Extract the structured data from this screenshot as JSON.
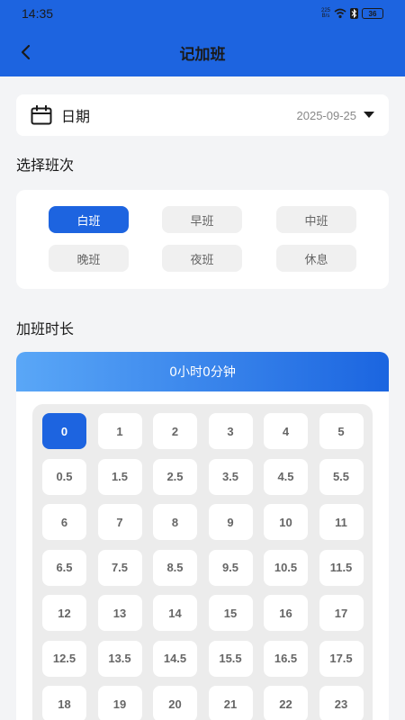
{
  "status_bar": {
    "time": "14:35",
    "net_speed_top": "225",
    "net_speed_bottom": "B/s",
    "battery": "36"
  },
  "header": {
    "title": "记加班"
  },
  "date_row": {
    "label": "日期",
    "value": "2025-09-25"
  },
  "shift_section": {
    "label": "选择班次",
    "options": [
      "白班",
      "早班",
      "中班",
      "晚班",
      "夜班",
      "休息"
    ],
    "selected_index": 0
  },
  "duration_section": {
    "label": "加班时长",
    "summary": "0小时0分钟",
    "hours": [
      "0",
      "1",
      "2",
      "3",
      "4",
      "5",
      "0.5",
      "1.5",
      "2.5",
      "3.5",
      "4.5",
      "5.5",
      "6",
      "7",
      "8",
      "9",
      "10",
      "11",
      "6.5",
      "7.5",
      "8.5",
      "9.5",
      "10.5",
      "11.5",
      "12",
      "13",
      "14",
      "15",
      "16",
      "17",
      "12.5",
      "13.5",
      "14.5",
      "15.5",
      "16.5",
      "17.5",
      "18",
      "19",
      "20",
      "21",
      "22",
      "23"
    ],
    "selected_index": 0
  },
  "colors": {
    "primary": "#1d64e0",
    "gradient_start": "#5aa7f7",
    "background": "#f3f4f6"
  }
}
